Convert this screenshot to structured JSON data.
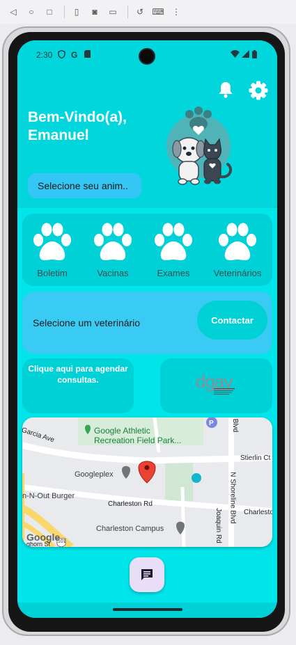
{
  "status_bar": {
    "time": "2:30",
    "icons": [
      "shield-icon",
      "google-icon",
      "sim-icon",
      "wifi-icon",
      "signal-icon",
      "battery-icon"
    ]
  },
  "header": {
    "welcome_line1": "Bem-Vindo(a),",
    "welcome_line2": "Emanuel",
    "select_animal_placeholder": "Selecione seu anim.."
  },
  "menu": {
    "items": [
      {
        "label": "Boletim",
        "icon": "paw-icon"
      },
      {
        "label": "Vacinas",
        "icon": "paw-icon"
      },
      {
        "label": "Exames",
        "icon": "paw-icon"
      },
      {
        "label": "Veterinários",
        "icon": "paw-icon"
      }
    ]
  },
  "vet": {
    "label": "Selecione um veterinário",
    "contact_button": "Contactar"
  },
  "schedule": {
    "label": "Clique aqui para agendar consultas."
  },
  "dgav": {
    "logo_text": "dgav"
  },
  "map": {
    "labels": {
      "park": "Google Athletic Recreation Field Park...",
      "googleplex": "Googleplex",
      "burger": "n-N-Out Burger",
      "charleston_rd": "Charleston Rd",
      "charleston_campus": "Charleston Campus",
      "garcia": "Garcia Ave",
      "stierlin": "Stierlin Ct",
      "shoreline": "N Shoreline Blvd",
      "charleston_right": "Charleston",
      "joaquin": "Joaquin Rd",
      "blvd": "Blvd",
      "google_logo": "Google",
      "amphitheatre": "ghorn St"
    },
    "highway_shield": "101"
  },
  "colors": {
    "screen_bg": "#00e5ea",
    "top_bg": "#00d6dc",
    "card_bg": "#00d1d6",
    "select_bg": "#34c6f5",
    "vet_card_bg": "#39cbf3",
    "fab_bg": "#e8def8"
  }
}
